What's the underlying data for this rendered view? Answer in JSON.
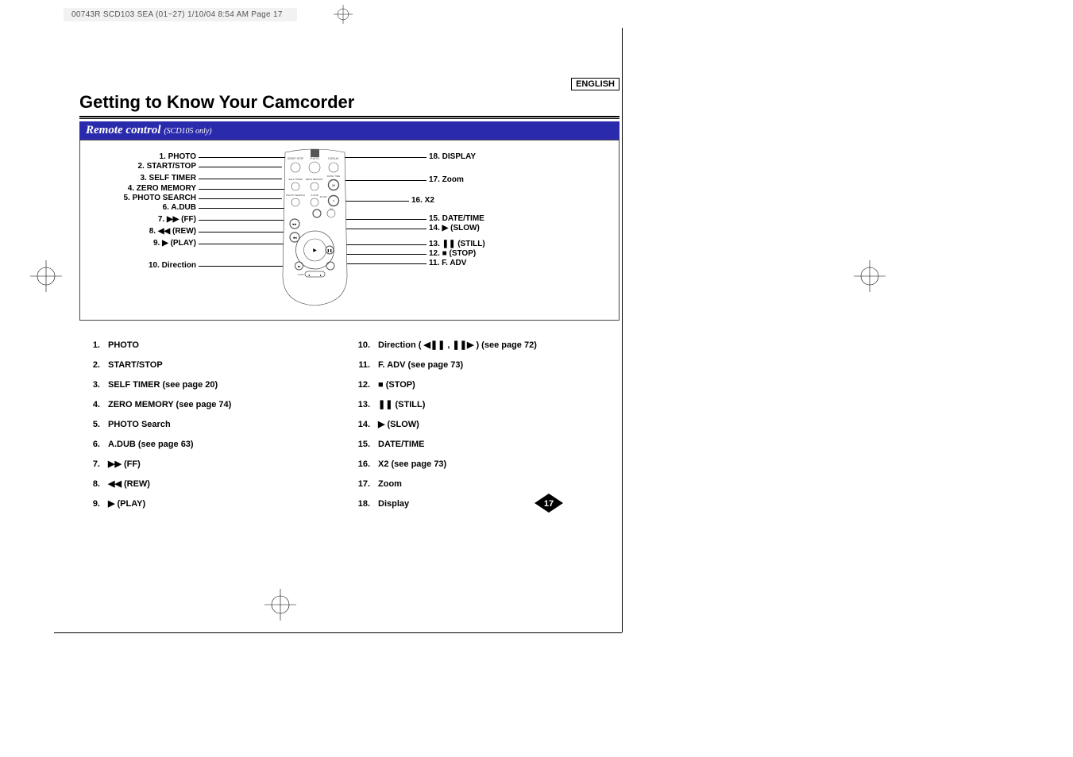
{
  "header": "00743R SCD103 SEA (01~27)  1/10/04 8:54 AM  Page 17",
  "language": "ENGLISH",
  "title": "Getting to Know Your Camcorder",
  "subtitle": "Remote control",
  "subtitle_note": "(SCD105 only)",
  "page_number": "17",
  "diagram_labels_left": [
    "1. PHOTO",
    "2. START/STOP",
    "3. SELF TIMER",
    "4. ZERO MEMORY",
    "5. PHOTO SEARCH",
    "6. A.DUB",
    "7. ▶▶ (FF)",
    "8. ◀◀ (REW)",
    "9. ▶ (PLAY)",
    "10. Direction"
  ],
  "diagram_labels_right": [
    "18. DISPLAY",
    "17. Zoom",
    "16. X2",
    "15. DATE/TIME",
    "14. ▶ (SLOW)",
    "13. ❚❚ (STILL)",
    "12. ■ (STOP)",
    "11. F. ADV"
  ],
  "remote_button_labels": {
    "start_stop": "START/\nSTOP",
    "photo": "PHOTO",
    "display": "DISPLAY",
    "self_timer": "SELF\nTIMER",
    "zero_memory": "ZERO\nMEMORY",
    "date_time": "DATE/\nTIME",
    "photo_search": "PHOTO\nSEARCH",
    "a_dub": "A.DUB",
    "slow": "SLOW",
    "x2": "X2",
    "f_adv": "F.ADV",
    "w": "W",
    "t": "T"
  },
  "list_left": [
    {
      "n": "1.",
      "t": "PHOTO"
    },
    {
      "n": "2.",
      "t": "START/STOP"
    },
    {
      "n": "3.",
      "t": "SELF TIMER (see page 20)"
    },
    {
      "n": "4.",
      "t": "ZERO MEMORY (see page 74)"
    },
    {
      "n": "5.",
      "t": "PHOTO Search"
    },
    {
      "n": "6.",
      "t": "A.DUB (see page 63)"
    },
    {
      "n": "7.",
      "t": "▶▶ (FF)"
    },
    {
      "n": "8.",
      "t": "◀◀ (REW)"
    },
    {
      "n": "9.",
      "t": "▶ (PLAY)"
    }
  ],
  "list_right": [
    {
      "n": "10.",
      "t": "Direction ( ◀❚❚ , ❚❚▶ ) (see page 72)"
    },
    {
      "n": "11.",
      "t": "F. ADV  (see page 73)"
    },
    {
      "n": "12.",
      "t": "■ (STOP)"
    },
    {
      "n": "13.",
      "t": "❚❚ (STILL)"
    },
    {
      "n": "14.",
      "t": "▶ (SLOW)"
    },
    {
      "n": "15.",
      "t": "DATE/TIME"
    },
    {
      "n": "16.",
      "t": "X2 (see page 73)"
    },
    {
      "n": "17.",
      "t": "Zoom"
    },
    {
      "n": "18.",
      "t": "Display"
    }
  ]
}
